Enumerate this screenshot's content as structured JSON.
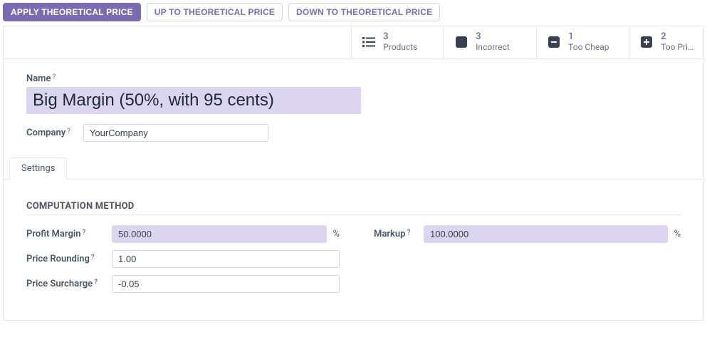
{
  "toolbar": {
    "apply": "APPLY THEORETICAL PRICE",
    "up": "UP TO THEORETICAL PRICE",
    "down": "DOWN TO THEORETICAL PRICE"
  },
  "stats": {
    "products": {
      "count": "3",
      "label": "Products"
    },
    "incorrect": {
      "count": "3",
      "label": "Incorrect"
    },
    "too_cheap": {
      "count": "1",
      "label": "Too Cheap"
    },
    "too_pricy": {
      "count": "2",
      "label": "Too Pri…"
    }
  },
  "form": {
    "name_label": "Name",
    "name_value": "Big Margin (50%, with 95 cents)",
    "company_label": "Company",
    "company_value": "YourCompany",
    "help_marker": "?"
  },
  "tabs": {
    "settings": "Settings"
  },
  "section": {
    "computation": "COMPUTATION METHOD"
  },
  "fields": {
    "profit_margin": {
      "label": "Profit Margin",
      "value": "50.0000",
      "unit": "%"
    },
    "markup": {
      "label": "Markup",
      "value": "100.0000",
      "unit": "%"
    },
    "price_rounding": {
      "label": "Price Rounding",
      "value": "1.00"
    },
    "price_surcharge": {
      "label": "Price Surcharge",
      "value": "-0.05"
    }
  }
}
